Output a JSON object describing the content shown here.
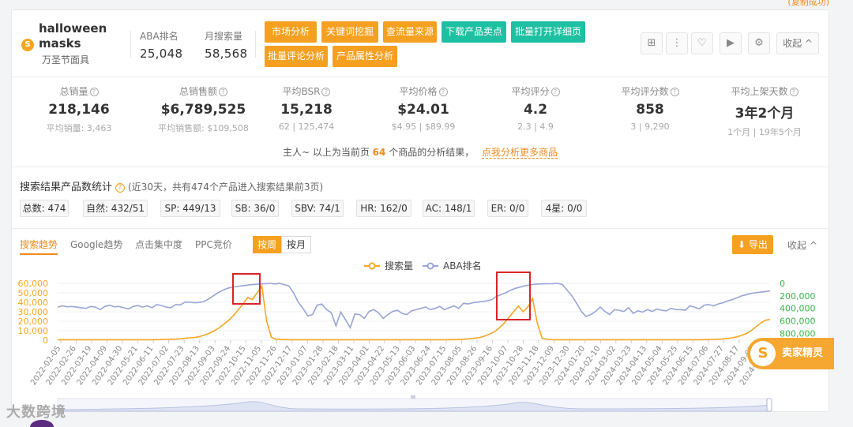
{
  "header": {
    "keyword": "halloween masks",
    "keyword_cn": "万圣节面具",
    "logo_glyph": "S",
    "aba_label": "ABA排名",
    "aba_value": "25,048",
    "monthly_label": "月搜索量",
    "monthly_value": "58,568",
    "buttons": {
      "market": "市场分析",
      "keyword_mining": "关键词挖掘",
      "traffic": "查流量来源",
      "download_points": "下载产品卖点",
      "batch_open": "批量打开详细页",
      "batch_review": "批量评论分析",
      "attributes": "产品属性分析"
    },
    "collapse": "收起 ^"
  },
  "stats": [
    {
      "label": "总销量",
      "value": "218,146",
      "sub": "平均销量: 3,463"
    },
    {
      "label": "总销售额",
      "value": "$6,789,525",
      "sub": "平均销售额: $109,508"
    },
    {
      "label": "平均BSR",
      "value": "15,218",
      "sub": "62 | 125,474"
    },
    {
      "label": "平均价格",
      "value": "$24.01",
      "sub": "$4.95 | $89.99"
    },
    {
      "label": "平均评分",
      "value": "4.2",
      "sub": "2.3 | 4.9"
    },
    {
      "label": "平均评分数",
      "value": "858",
      "sub": "3 | 9,290"
    },
    {
      "label": "平均上架天数",
      "value": "3年2个月",
      "sub": "1个月 | 19年5个月"
    }
  ],
  "summary": {
    "prefix": "主人~ 以上为当前页",
    "count": "64",
    "suffix": "个商品的分析结果，",
    "link": "点我分析更多商品"
  },
  "search_stats": {
    "title": "搜索结果产品数统计",
    "hint": "(近30天，共有474个产品进入搜索结果前3页)",
    "chips": [
      "总数: 474",
      "自然: 432/51",
      "SP: 449/13",
      "SB: 36/0",
      "SBV: 74/1",
      "HR: 162/0",
      "AC: 148/1",
      "ER: 0/0",
      "4星: 0/0"
    ]
  },
  "trend": {
    "tabs": [
      "搜索趋势",
      "Google趋势",
      "点击集中度",
      "PPC竞价"
    ],
    "toggle_week": "按周",
    "toggle_month": "按月",
    "export": "导出",
    "collapse": "收起 ^"
  },
  "chart_data": {
    "type": "line",
    "legend_position": "top-center",
    "series": [
      {
        "name": "搜索量",
        "color": "#f5a623",
        "axis": "left",
        "values": [
          500,
          500,
          500,
          500,
          500,
          500,
          500,
          500,
          500,
          500,
          500,
          500,
          500,
          500,
          500,
          500,
          500,
          500,
          500,
          500,
          500,
          600,
          700,
          800,
          1000,
          1200,
          1500,
          2000,
          2500,
          3000,
          4000,
          5500,
          7500,
          10000,
          13000,
          17000,
          21000,
          26000,
          32000,
          38000,
          45000,
          43000,
          50000,
          57000,
          20000,
          3000,
          1000,
          700,
          600,
          500,
          500,
          500,
          500,
          500,
          500,
          500,
          500,
          500,
          500,
          500,
          500,
          500,
          500,
          500,
          500,
          500,
          500,
          500,
          500,
          500,
          500,
          500,
          500,
          500,
          500,
          500,
          500,
          500,
          500,
          500,
          500,
          500,
          500,
          600,
          700,
          900,
          1200,
          1600,
          2200,
          3000,
          4500,
          6500,
          9000,
          13000,
          18000,
          24000,
          30000,
          36000,
          30000,
          35000,
          44000,
          18000,
          2000,
          800,
          600,
          500,
          500,
          500,
          500,
          500,
          500,
          500,
          500,
          500,
          500,
          500,
          500,
          500,
          500,
          500,
          500,
          500,
          500,
          500,
          500,
          500,
          500,
          500,
          500,
          500,
          500,
          500,
          500,
          500,
          500,
          500,
          600,
          700,
          800,
          1000,
          1300,
          1800,
          2500,
          3500,
          5000,
          7000,
          10000,
          14000,
          18000,
          21000,
          22000
        ]
      },
      {
        "name": "ABA排名",
        "color": "#9aa5d6",
        "axis": "right",
        "values": [
          380000,
          360000,
          375000,
          370000,
          380000,
          390000,
          400000,
          370000,
          380000,
          420000,
          370000,
          350000,
          375000,
          370000,
          390000,
          410000,
          370000,
          355000,
          380000,
          360000,
          390000,
          340000,
          355000,
          380000,
          390000,
          340000,
          345000,
          300000,
          300000,
          310000,
          305000,
          290000,
          250000,
          200000,
          150000,
          110000,
          80000,
          60000,
          50000,
          40000,
          30000,
          22000,
          15000,
          10000,
          5000,
          0,
          10000,
          0,
          20000,
          40000,
          150000,
          300000,
          400000,
          520000,
          500000,
          350000,
          330000,
          420000,
          470000,
          680000,
          460000,
          580000,
          710000,
          490000,
          500000,
          560000,
          450000,
          420000,
          470000,
          560000,
          500000,
          450000,
          430000,
          480000,
          500000,
          440000,
          420000,
          400000,
          380000,
          420000,
          400000,
          370000,
          420000,
          390000,
          360000,
          400000,
          320000,
          330000,
          310000,
          300000,
          290000,
          280000,
          260000,
          210000,
          180000,
          150000,
          110000,
          80000,
          60000,
          40000,
          25000,
          15000,
          10000,
          8000,
          6000,
          5000,
          0,
          20000,
          110000,
          200000,
          320000,
          450000,
          530000,
          500000,
          450000,
          380000,
          450000,
          500000,
          420000,
          430000,
          450000,
          390000,
          480000,
          440000,
          460000,
          420000,
          450000,
          410000,
          430000,
          440000,
          400000,
          420000,
          420000,
          430000,
          360000,
          380000,
          410000,
          350000,
          340000,
          360000,
          330000,
          310000,
          280000,
          260000,
          230000,
          200000,
          180000,
          160000,
          150000,
          140000,
          130000,
          120000
        ]
      }
    ],
    "x_labels": [
      "2022-02-05",
      "2022-02-26",
      "2022-03-19",
      "2022-04-09",
      "2022-04-30",
      "2022-05-21",
      "2022-06-11",
      "2022-07-02",
      "2022-07-23",
      "2022-08-13",
      "2022-09-03",
      "2022-09-24",
      "2022-10-15",
      "2022-11-05",
      "2022-11-26",
      "2022-12-17",
      "2023-01-07",
      "2023-01-28",
      "2023-02-18",
      "2023-03-11",
      "2023-04-01",
      "2023-04-22",
      "2023-05-13",
      "2023-06-03",
      "2023-06-24",
      "2023-07-15",
      "2023-08-05",
      "2023-08-26",
      "2023-09-16",
      "2023-10-07",
      "2023-10-28",
      "2023-11-18",
      "2023-12-09",
      "2023-12-30",
      "2024-01-20",
      "2024-02-10",
      "2024-03-02",
      "2024-03-23",
      "2024-04-13",
      "2024-05-04",
      "2024-05-25",
      "2024-06-15",
      "2024-07-06",
      "2024-07-27",
      "2024-08-17",
      "2024-09-07",
      "2024-09-28"
    ],
    "y_left_ticks": [
      "60,000",
      "50,000",
      "40,000",
      "30,000",
      "20,000",
      "10,000",
      "0"
    ],
    "y_left_range": [
      0,
      60000
    ],
    "y_right_ticks": [
      "0",
      "200,000",
      "400,000",
      "600,000",
      "800,000"
    ],
    "y_right_range": [
      0,
      800000
    ],
    "y_right_inverted": true
  },
  "brand": {
    "name": "卖家精灵",
    "glyph": "S"
  },
  "watermark": "大数跨境",
  "top_note": "(复制成功)"
}
